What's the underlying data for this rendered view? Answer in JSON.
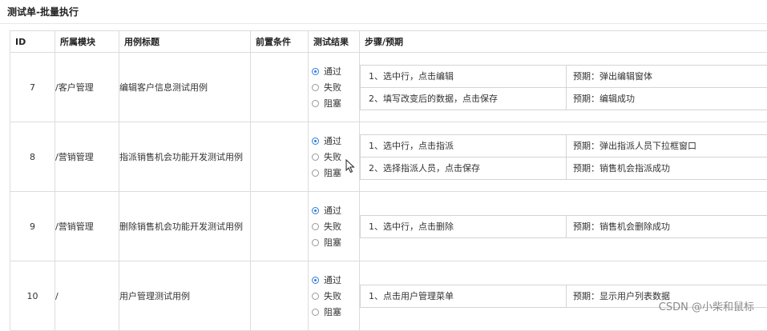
{
  "page": {
    "title": "测试单-批量执行"
  },
  "columns": [
    "ID",
    "所属模块",
    "用例标题",
    "前置条件",
    "测试结果",
    "步骤/预期"
  ],
  "radio_options": [
    "通过",
    "失败",
    "阻塞"
  ],
  "rows": [
    {
      "id": "7",
      "module": "/客户管理",
      "title": "编辑客户信息测试用例",
      "precondition": "",
      "steps": [
        {
          "step": "1、选中行，点击编辑",
          "expect": "预期：弹出编辑窗体"
        },
        {
          "step": "2、填写改变后的数据，点击保存",
          "expect": "预期：编辑成功"
        }
      ]
    },
    {
      "id": "8",
      "module": "/营销管理",
      "title": "指派销售机会功能开发测试用例",
      "precondition": "",
      "steps": [
        {
          "step": "1、选中行，点击指派",
          "expect": "预期：弹出指派人员下拉框窗口"
        },
        {
          "step": "2、选择指派人员，点击保存",
          "expect": "预期：销售机会指派成功"
        }
      ]
    },
    {
      "id": "9",
      "module": "/营销管理",
      "title": "删除销售机会功能开发测试用例",
      "precondition": "",
      "steps": [
        {
          "step": "1、选中行，点击删除",
          "expect": "预期：销售机会删除成功"
        }
      ]
    },
    {
      "id": "10",
      "module": "/",
      "title": "用户管理测试用例",
      "precondition": "",
      "steps": [
        {
          "step": "1、点击用户管理菜单",
          "expect": "预期：显示用户列表数据"
        }
      ]
    }
  ],
  "selected_result": "通过",
  "watermark": "CSDN @小柴和鼠标",
  "colors": {
    "accent": "#2d7ddb",
    "border": "#dcdcdc"
  }
}
